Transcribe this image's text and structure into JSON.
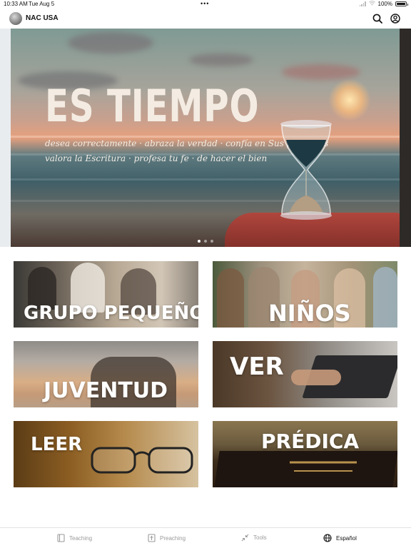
{
  "status_bar": {
    "time": "10:33 AM",
    "date": "Tue Aug 5",
    "dots": "•••",
    "battery": "100%"
  },
  "header": {
    "brand": "NAC USA",
    "search_icon": "search-icon",
    "account_icon": "user-circle-icon"
  },
  "hero": {
    "title": "ES TIEMPO",
    "subtitle_line1": "desea correctamente · abraza la verdad · confía en Sus promesas",
    "subtitle_line2": "valora la Escritura · profesa tu fe · de hacer el bien",
    "page_count": 3,
    "current_page": 1
  },
  "tiles": [
    {
      "label": "GRUPO PEQUEÑO"
    },
    {
      "label": "NIÑOS"
    },
    {
      "label": "JUVENTUD"
    },
    {
      "label": "VER"
    },
    {
      "label": "LEER"
    },
    {
      "label": "PRÉDICA"
    }
  ],
  "tabs": [
    {
      "label": "Teaching",
      "icon": "book-icon",
      "active": false
    },
    {
      "label": "Preaching",
      "icon": "bible-cross-icon",
      "active": false
    },
    {
      "label": "Tools",
      "icon": "collapse-arrows-icon",
      "active": false
    },
    {
      "label": "Español",
      "icon": "globe-icon",
      "active": true
    }
  ],
  "colors": {
    "accent": "#111111",
    "inactive_tab": "#9a9a9a"
  }
}
